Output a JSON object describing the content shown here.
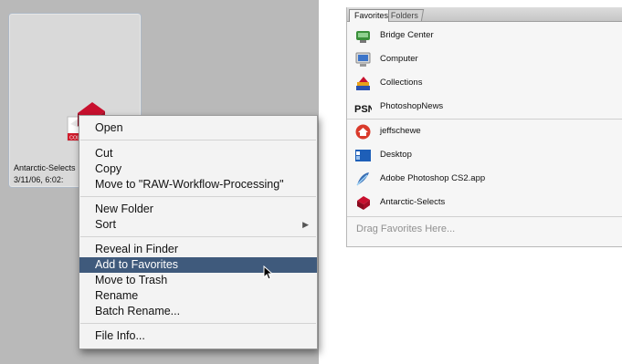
{
  "thumbnail": {
    "name": "Antarctic-Selects",
    "date": "3/11/06, 6:02:",
    "icon_badge": "COLL",
    "icon": "collection-icon"
  },
  "context_menu": {
    "items": [
      {
        "label": "Open"
      },
      {
        "label": "Cut"
      },
      {
        "label": "Copy"
      },
      {
        "label": "Move to \"RAW-Workflow-Processing\""
      },
      {
        "label": "New Folder"
      },
      {
        "label": "Sort",
        "submenu_arrow": "▶"
      },
      {
        "label": "Reveal in Finder"
      },
      {
        "label": "Add to Favorites",
        "highlighted": true
      },
      {
        "label": "Move to Trash"
      },
      {
        "label": "Rename"
      },
      {
        "label": "Batch Rename..."
      },
      {
        "label": "File Info..."
      }
    ],
    "highlight_color": "#3f5a7c"
  },
  "favorites_panel": {
    "tabs": [
      {
        "label": "Favorites",
        "active": true
      },
      {
        "label": "Folders",
        "active": false
      }
    ],
    "items": [
      {
        "label": "Bridge Center",
        "icon": "bridge-center-icon"
      },
      {
        "label": "Computer",
        "icon": "computer-icon"
      },
      {
        "label": "Collections",
        "icon": "collections-icon"
      },
      {
        "label": "PhotoshopNews",
        "icon": "psn-icon",
        "icon_text": "PSN"
      },
      {
        "label": "jeffschewe",
        "icon": "home-folder-icon"
      },
      {
        "label": "Desktop",
        "icon": "desktop-icon"
      },
      {
        "label": "Adobe Photoshop CS2.app",
        "icon": "photoshop-app-icon"
      },
      {
        "label": "Antarctic-Selects",
        "icon": "collection-icon"
      }
    ],
    "drag_hint": "Drag Favorites Here..."
  }
}
